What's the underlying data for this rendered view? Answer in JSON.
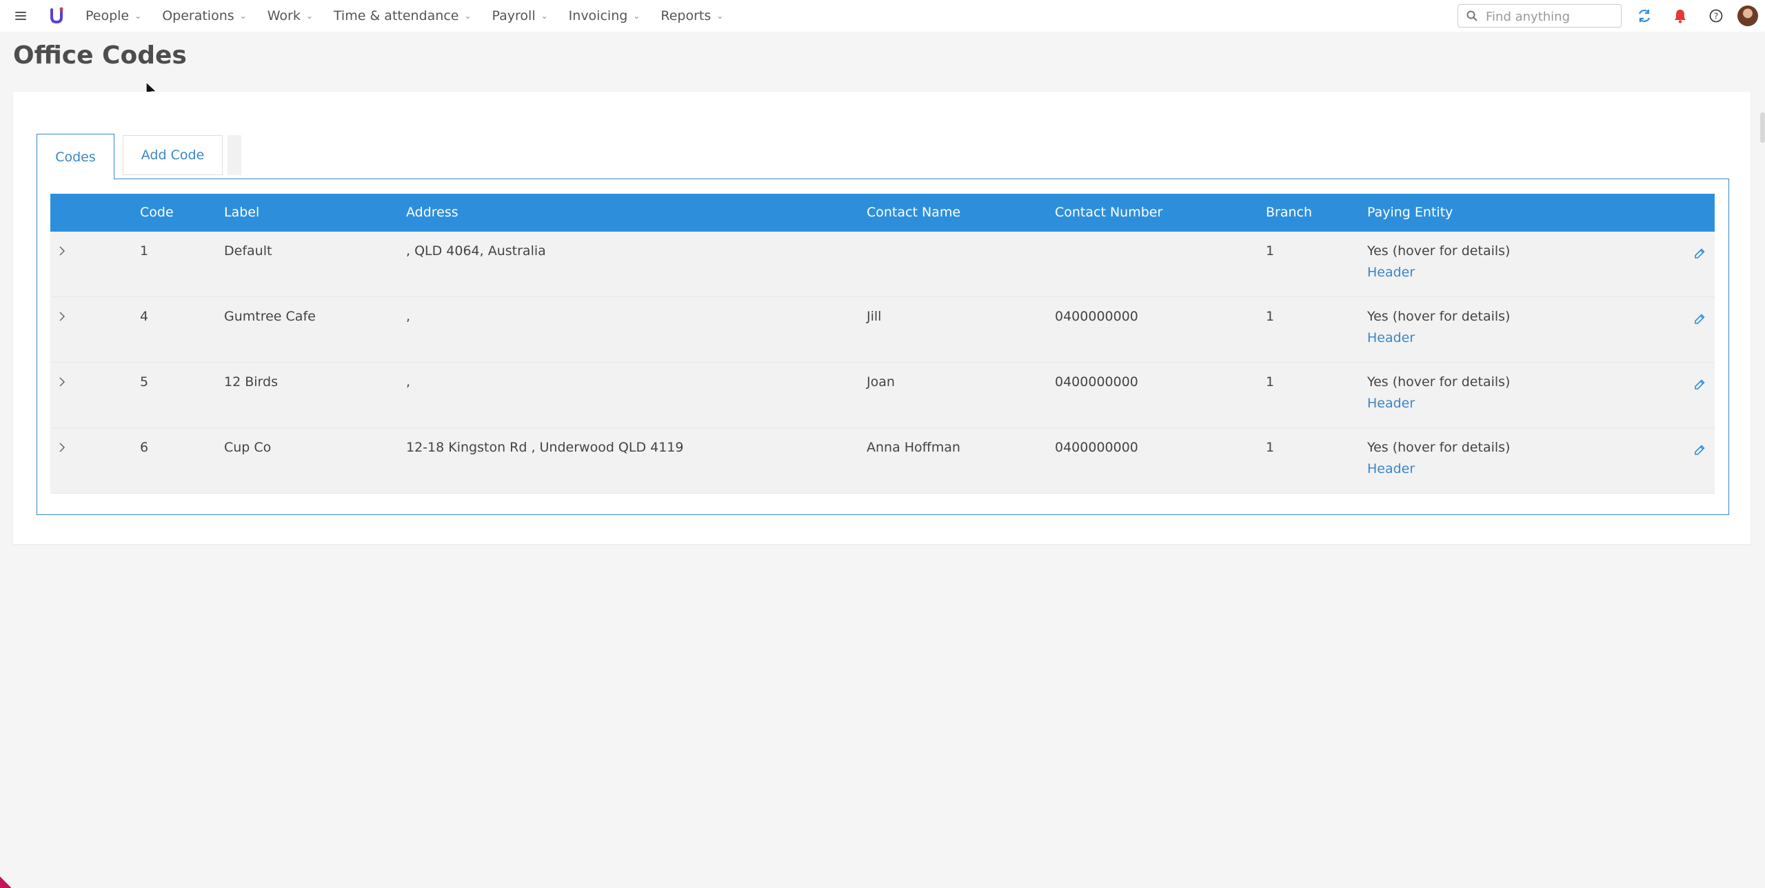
{
  "nav": {
    "items": [
      {
        "label": "People"
      },
      {
        "label": "Operations"
      },
      {
        "label": "Work"
      },
      {
        "label": "Time & attendance"
      },
      {
        "label": "Payroll"
      },
      {
        "label": "Invoicing"
      },
      {
        "label": "Reports"
      }
    ],
    "search_placeholder": "Find anything"
  },
  "page": {
    "title": "Office Codes"
  },
  "tabs": {
    "codes": "Codes",
    "add_code": "Add Code"
  },
  "table": {
    "headers": [
      "Code",
      "Label",
      "Address",
      "Contact Name",
      "Contact Number",
      "Branch",
      "Paying Entity"
    ],
    "rows": [
      {
        "code": "1",
        "label": "Default",
        "address": ", QLD 4064, Australia",
        "contact_name": "",
        "contact_number": "",
        "branch": "1",
        "paying_entity": "Yes (hover for details)",
        "link": "Header"
      },
      {
        "code": "4",
        "label": "Gumtree Cafe",
        "address": ",",
        "contact_name": "Jill",
        "contact_number": "0400000000",
        "branch": "1",
        "paying_entity": "Yes (hover for details)",
        "link": "Header"
      },
      {
        "code": "5",
        "label": "12 Birds",
        "address": ",",
        "contact_name": "Joan",
        "contact_number": "0400000000",
        "branch": "1",
        "paying_entity": "Yes (hover for details)",
        "link": "Header"
      },
      {
        "code": "6",
        "label": "Cup Co",
        "address": "12-18 Kingston Rd , Underwood QLD 4119",
        "contact_name": "Anna Hoffman",
        "contact_number": "0400000000",
        "branch": "1",
        "paying_entity": "Yes (hover for details)",
        "link": "Header"
      }
    ]
  },
  "colors": {
    "accent": "#2d8fdb",
    "link": "#3a86c8",
    "notification": "#e53935",
    "logo": "#5b3fd6"
  },
  "icons": [
    "hamburger-icon",
    "logo-icon",
    "search-icon",
    "refresh-icon",
    "bell-icon",
    "help-icon",
    "chevron-right-icon",
    "pencil-icon"
  ]
}
